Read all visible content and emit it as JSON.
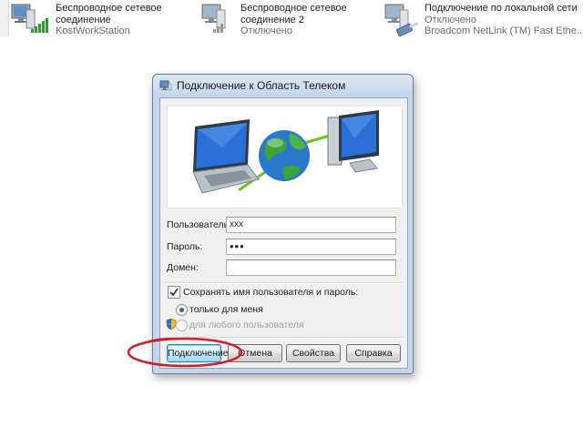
{
  "connections": [
    {
      "name_line1": "Беспроводное сетевое",
      "name_line2": "соединение",
      "status": "KostWorkStation",
      "icon": "wireless-network-icon"
    },
    {
      "name_line1": "Беспроводное сетевое",
      "name_line2": "соединение 2",
      "status": "Отключено",
      "icon": "wireless-network-disconnected-icon"
    },
    {
      "name_line1": "Подключение по локальной сети",
      "name_line2": "Отключено",
      "status": "Broadcom NetLink (TM) Fast Ethe...",
      "icon": "lan-connection-icon"
    }
  ],
  "dialog": {
    "title": "Подключение к Область Телеком",
    "user_label": "Пользователь:",
    "user_value": "xxx",
    "password_label": "Пароль:",
    "password_value": "•••",
    "domain_label": "Домен:",
    "domain_value": "",
    "save_checkbox_label": "Сохранять имя пользователя и пароль:",
    "save_checked": true,
    "radio_only_me": "только для меня",
    "radio_any_user": "для любого пользователя",
    "buttons": {
      "connect": "Подключение",
      "cancel": "Отмена",
      "properties": "Свойства",
      "help": "Справка"
    }
  },
  "colors": {
    "annotation": "#c8232c",
    "dialog_frame": "#c6d7ec"
  }
}
